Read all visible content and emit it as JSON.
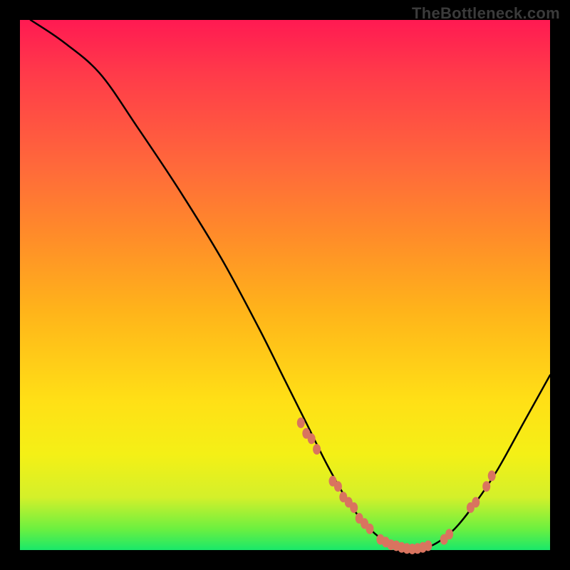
{
  "watermark": "TheBottleneck.com",
  "colors": {
    "background": "#000000",
    "gradient_top": "#ff1a52",
    "gradient_bottom": "#19e86a",
    "curve": "#000000",
    "dots": "#d9745f"
  },
  "chart_data": {
    "type": "line",
    "title": "",
    "xlabel": "",
    "ylabel": "",
    "xlim": [
      0,
      100
    ],
    "ylim": [
      0,
      100
    ],
    "curve": {
      "x": [
        2,
        8,
        15,
        22,
        30,
        38,
        45,
        50,
        54,
        58,
        62,
        66,
        70,
        74,
        78,
        82,
        86,
        90,
        95,
        100
      ],
      "y": [
        100,
        96,
        90,
        80,
        68,
        55,
        42,
        32,
        24,
        16,
        9,
        4,
        1,
        0,
        1,
        4,
        9,
        15,
        24,
        33
      ]
    },
    "markers": [
      {
        "x": 53,
        "y": 24
      },
      {
        "x": 54,
        "y": 22
      },
      {
        "x": 55,
        "y": 21
      },
      {
        "x": 56,
        "y": 19
      },
      {
        "x": 59,
        "y": 13
      },
      {
        "x": 60,
        "y": 12
      },
      {
        "x": 61,
        "y": 10
      },
      {
        "x": 62,
        "y": 9
      },
      {
        "x": 63,
        "y": 8
      },
      {
        "x": 64,
        "y": 6
      },
      {
        "x": 65,
        "y": 5
      },
      {
        "x": 66,
        "y": 4
      },
      {
        "x": 68,
        "y": 2
      },
      {
        "x": 69,
        "y": 1.5
      },
      {
        "x": 70,
        "y": 1
      },
      {
        "x": 71,
        "y": 0.8
      },
      {
        "x": 72,
        "y": 0.5
      },
      {
        "x": 73,
        "y": 0.3
      },
      {
        "x": 74,
        "y": 0.2
      },
      {
        "x": 75,
        "y": 0.3
      },
      {
        "x": 76,
        "y": 0.5
      },
      {
        "x": 77,
        "y": 0.8
      },
      {
        "x": 80,
        "y": 2
      },
      {
        "x": 81,
        "y": 3
      },
      {
        "x": 85,
        "y": 8
      },
      {
        "x": 86,
        "y": 9
      },
      {
        "x": 88,
        "y": 12
      },
      {
        "x": 89,
        "y": 14
      }
    ]
  }
}
